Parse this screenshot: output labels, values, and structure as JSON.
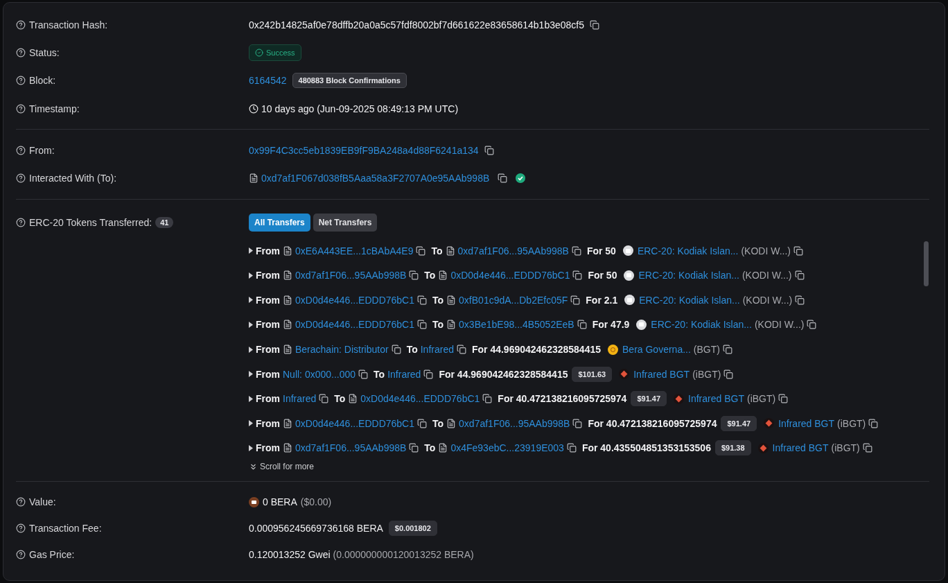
{
  "transaction_hash": {
    "label": "Transaction Hash:",
    "value": "0x242b14825af0e78dffb20a0a5c57fdf8002bf7d661622e83658614b1b3e08cf5"
  },
  "status": {
    "label": "Status:",
    "value": "Success",
    "kind": "success"
  },
  "block": {
    "label": "Block:",
    "number": "6164542",
    "confirmations": "480883 Block Confirmations"
  },
  "timestamp": {
    "label": "Timestamp:",
    "value": "10 days ago (Jun-09-2025 08:49:13 PM UTC)"
  },
  "from": {
    "label": "From:",
    "address": "0x99F4C3cc5eb1839EB9fF9BA248a4d88F6241a134"
  },
  "interacted_with": {
    "label": "Interacted With (To):",
    "address": "0xd7af1F067d038fB5Aaa58a3F2707A0e95AAb998B",
    "contract": true,
    "verified": true
  },
  "tokens_transferred": {
    "label": "ERC-20 Tokens Transferred:",
    "count": "41",
    "tabs": [
      {
        "label": "All Transfers",
        "selected": true
      },
      {
        "label": "Net Transfers",
        "selected": false
      }
    ],
    "transfers": [
      {
        "from_label": "From",
        "from": "0xE6A443EE...1cBAbA4E9",
        "from_contract": true,
        "to_label": "To",
        "to": "0xd7af1F06...95AAb998B",
        "to_contract": true,
        "amount": "For 50",
        "kind": "kodi",
        "token": "ERC-20: Kodiak Islan...",
        "symbol": "(KODI W...)"
      },
      {
        "from_label": "From",
        "from": "0xd7af1F06...95AAb998B",
        "from_contract": true,
        "to_label": "To",
        "to": "0xD0d4e446...EDDD76bC1",
        "to_contract": true,
        "amount": "For 50",
        "kind": "kodi",
        "token": "ERC-20: Kodiak Islan...",
        "symbol": "(KODI W...)"
      },
      {
        "from_label": "From",
        "from": "0xD0d4e446...EDDD76bC1",
        "from_contract": true,
        "to_label": "To",
        "to": "0xfB01c9dA...Db2Efc05F",
        "to_contract": true,
        "amount": "For 2.1",
        "kind": "kodi",
        "token": "ERC-20: Kodiak Islan...",
        "symbol": "(KODI W...)"
      },
      {
        "from_label": "From",
        "from": "0xD0d4e446...EDDD76bC1",
        "from_contract": true,
        "to_label": "To",
        "to": "0x3Be1bE98...4B5052EeB",
        "to_contract": true,
        "amount": "For 47.9",
        "kind": "kodi",
        "token": "ERC-20: Kodiak Islan...",
        "symbol": "(KODI W...)"
      },
      {
        "from_label": "From",
        "from": "Berachain: Distributor",
        "from_contract": true,
        "to_label": "To",
        "to": "Infrared",
        "to_contract": false,
        "amount": "For 44.969042462328584415",
        "kind": "bgt",
        "token": "Bera Governa...",
        "symbol": "(BGT)"
      },
      {
        "from_label": "From",
        "from": "Null: 0x000...000",
        "from_contract": false,
        "to_label": "To",
        "to": "Infrared",
        "to_contract": false,
        "amount": "For 44.969042462328584415",
        "usd": "$101.63",
        "kind": "ibgt",
        "token": "Infrared BGT",
        "symbol": "(iBGT)"
      },
      {
        "from_label": "From",
        "from": "Infrared",
        "from_contract": false,
        "to_label": "To",
        "to": "0xD0d4e446...EDDD76bC1",
        "to_contract": true,
        "amount": "For 40.472138216095725974",
        "usd": "$91.47",
        "kind": "ibgt",
        "token": "Infrared BGT",
        "symbol": "(iBGT)"
      },
      {
        "from_label": "From",
        "from": "0xD0d4e446...EDDD76bC1",
        "from_contract": true,
        "to_label": "To",
        "to": "0xd7af1F06...95AAb998B",
        "to_contract": true,
        "amount": "For 40.472138216095725974",
        "usd": "$91.47",
        "kind": "ibgt",
        "token": "Infrared BGT",
        "symbol": "(iBGT)"
      },
      {
        "from_label": "From",
        "from": "0xd7af1F06...95AAb998B",
        "from_contract": true,
        "to_label": "To",
        "to": "0x4Fe93ebC...23919E003",
        "to_contract": true,
        "amount": "For 40.435504851353153506",
        "usd": "$91.38",
        "kind": "ibgt",
        "token": "Infrared BGT",
        "symbol": "(iBGT)"
      }
    ],
    "scroll_hint": "Scroll for more"
  },
  "value": {
    "label": "Value:",
    "amount": "0 BERA",
    "usd": "($0.00)"
  },
  "transaction_fee": {
    "label": "Transaction Fee:",
    "amount": "0.000956245669736168 BERA",
    "usd": "$0.001802"
  },
  "gas_price": {
    "label": "Gas Price:",
    "amount": "0.120013252 Gwei",
    "detail": "(0.000000000120013252 BERA)"
  }
}
